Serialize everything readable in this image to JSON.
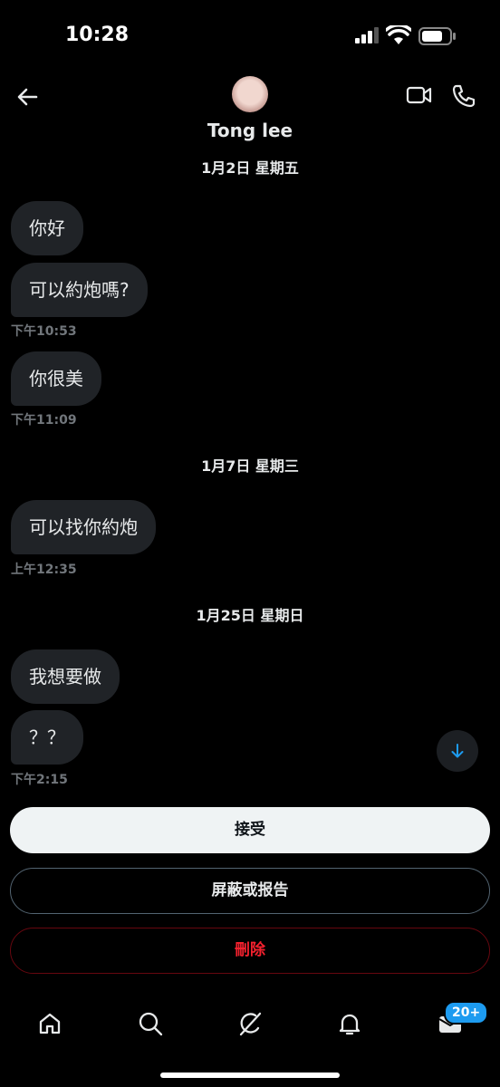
{
  "status_bar": {
    "time": "10:28"
  },
  "header": {
    "name": "Tong lee"
  },
  "conversation": {
    "sections": [
      {
        "date": "1月2日 星期五"
      },
      {
        "date": "1月7日 星期三"
      },
      {
        "date": "1月25日 星期日"
      }
    ],
    "messages": [
      {
        "text": "你好"
      },
      {
        "text": "可以約炮嗎?",
        "time": "下午10:53"
      },
      {
        "text": "你很美",
        "time": "下午11:09"
      },
      {
        "text": "可以找你約炮",
        "time": "上午12:35"
      },
      {
        "text": "我想要做"
      },
      {
        "text": "？？",
        "time": "下午2:15"
      }
    ]
  },
  "actions": {
    "accept": "接受",
    "block_report": "屏蔽或报告",
    "delete": "刪除"
  },
  "tab_bar": {
    "items": [
      "home-icon",
      "search-icon",
      "grok-icon",
      "notifications-icon",
      "messages-icon"
    ],
    "messages_badge": "20+"
  },
  "colors": {
    "background": "#000000",
    "bubble": "#202327",
    "accent": "#1d9bf0",
    "danger": "#f4212e"
  }
}
